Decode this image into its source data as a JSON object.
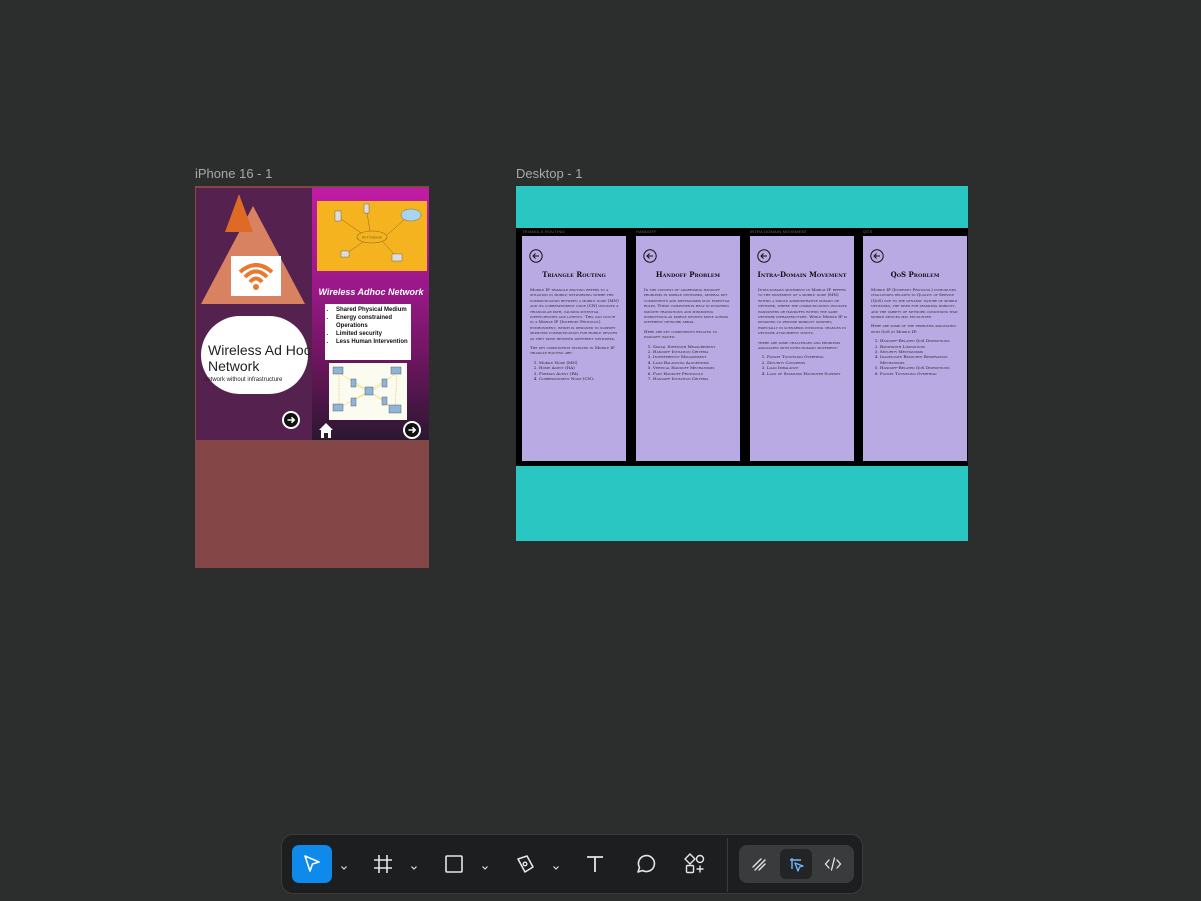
{
  "canvas": {
    "frames": [
      {
        "label": "iPhone 16 - 1"
      },
      {
        "label": "Desktop - 1"
      }
    ]
  },
  "iphone": {
    "screen1": {
      "title": "Wireless Ad Hoc Network",
      "subtitle": "network without infrastructure"
    },
    "screen2": {
      "diagram_label": "WiFi Network",
      "title": "Wireless Adhoc Network",
      "bullets": [
        "Shared Physical Medium",
        "Energy constrained Operations",
        "Limited security",
        "Less Human Intervention"
      ]
    }
  },
  "desktop": {
    "cards": [
      {
        "tag": "TRIANGLE ROUTING",
        "title": "Triangle Routing",
        "paragraphs": [
          "Mobile IP triangle routing refers to a situation in mobile networking where the communication between a mobile node (MN) and its correspondent node (CN) involves a triangular path, causing potential inefficiencies and latency. This can occur in a Mobile IP (Internet Protocol) environment, which is designed to support seamless communication for mobile devices as they move between different networks.",
          "The key components involved in Mobile IP triangle routing are:"
        ],
        "items": [
          "Mobile Node (MN)",
          "Home Agent (HA)",
          "Foreign Agent (FA)",
          "Correspondent Node (CN):"
        ]
      },
      {
        "tag": "HANDOFF",
        "title": "Handoff Problem",
        "paragraphs": [
          "In the context of addressing handoff problems in mobile networks, several key components and mechanisms play essential roles. These components help in ensuring smooth transitions and minimizing disruptions as mobile devices move across different network areas.",
          "Here are key components related to handoff issues:"
        ],
        "items": [
          "Signal Strength Measurement",
          "Handoff Initiation Criteria",
          "Interference Management",
          "Load Balancing Algorithms",
          "Vertical Handoff Mechanisms",
          "Fast Handoff Protocols",
          "Handoff Initiation Criteria"
        ]
      },
      {
        "tag": "INTRA DOMAIN MOVEMENT",
        "title": "Intra-Domain Movement",
        "paragraphs": [
          "Intra-domain movement in Mobile IP refers to the movement of a mobile node (MN) within a single administrative domain or network, where the communication involves handovers or handoffs within the same network infrastructure. While Mobile IP is designed to provide mobility support, especially in scenarios involving changes in network attachment points.",
          "there are some challenges and problems associated with intra-domain movement:"
        ],
        "items": [
          "Packet Tunneling Overhead",
          "Security Concerns",
          "Load Imbalance",
          "Lack of Seamless Handover Support"
        ]
      },
      {
        "tag": "QOS",
        "title": "QoS Problem",
        "paragraphs": [
          "Mobile IP (Internet Protocol) introduces challenges related to Quality of Service (QoS) due to the dynamic nature of mobile networks, the need for seamless mobility, and the variety of network conditions that mobile devices may encounter.",
          "Here are some of the problems associated with QoS in Mobile IP:"
        ],
        "items": [
          "Handoff-Related QoS Disruptions",
          "Bandwidth Limitations",
          "Security Mechanisms",
          "Inadequate Resource Reservation Mechanisms",
          "Handoff-Related QoS Disruptions",
          "Packet Tunneling Overhead"
        ]
      }
    ]
  },
  "toolbar": {
    "tools": [
      "move-tool",
      "frame-tool",
      "shape-tool",
      "pen-tool",
      "text-tool",
      "comment-tool",
      "actions-tool"
    ],
    "modes": [
      "draw-mode",
      "design-mode",
      "dev-mode"
    ],
    "active_tool": "move-tool",
    "active_mode": "design-mode",
    "accent": "#0d8aea"
  }
}
